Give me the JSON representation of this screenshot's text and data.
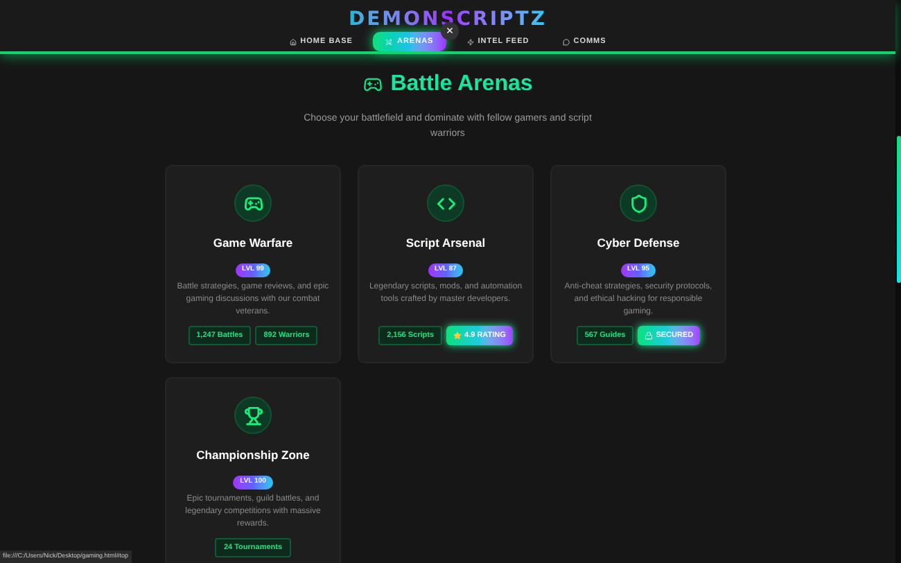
{
  "header": {
    "logo": "DEMONSCRIPTZ",
    "close_button": "×",
    "nav": [
      {
        "label": "HOME BASE",
        "kind": "home",
        "selected": false
      },
      {
        "label": "ARENAS",
        "kind": "arenas",
        "selected": true
      },
      {
        "label": "INTEL FEED",
        "kind": "intel",
        "selected": false
      },
      {
        "label": "COMMS",
        "kind": "comms",
        "selected": false
      }
    ]
  },
  "hero": {
    "title": "Battle Arenas",
    "subtitle": "Choose your battlefield and dominate with fellow gamers and script warriors"
  },
  "cards": [
    {
      "kind": "games",
      "title": "Game Warfare",
      "level": "LVL 99",
      "description": "Battle strategies, game reviews, and epic gaming discussions with our combat veterans.",
      "stats": [
        {
          "label": "1,247 Battles",
          "kind": "count"
        },
        {
          "label": "892 Warriors",
          "kind": "count"
        }
      ]
    },
    {
      "kind": "code",
      "title": "Script Arsenal",
      "level": "LVL 87",
      "description": "Legendary scripts, mods, and automation tools crafted by master developers.",
      "stats": [
        {
          "label": "2,156 Scripts",
          "kind": "count"
        },
        {
          "label": "4.9 RATING",
          "kind": "rating"
        }
      ]
    },
    {
      "kind": "security",
      "title": "Cyber Defense",
      "level": "LVL 95",
      "description": "Anti-cheat strategies, security protocols, and ethical hacking for responsible gaming.",
      "stats": [
        {
          "label": "567 Guides",
          "kind": "count"
        },
        {
          "label": "SECURED",
          "kind": "secured"
        }
      ]
    },
    {
      "kind": "trophy",
      "title": "Championship Zone",
      "level": "LVL 100",
      "description": "Epic tournaments, guild battles, and legendary competitions with massive rewards.",
      "stats": [
        {
          "label": "24 Tournaments",
          "kind": "count"
        }
      ]
    }
  ],
  "status_bar": "file:///C:/Users/Nick/Desktop/gaming.html#top"
}
